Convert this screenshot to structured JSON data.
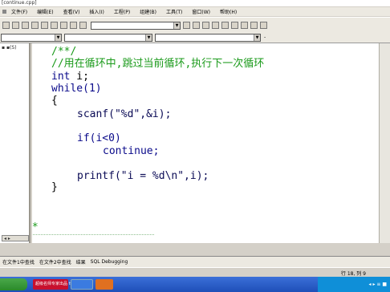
{
  "window": {
    "title": "[continue.cpp]"
  },
  "menu": {
    "items": [
      "文件(F)",
      "编辑(E)",
      "查看(V)",
      "插入(I)",
      "工程(P)",
      "组建(B)",
      "工具(T)",
      "窗口(W)",
      "帮助(H)"
    ]
  },
  "toolbar": {
    "minus_label": "-"
  },
  "leftpane": {
    "header": "▪ ▪(S)",
    "tab_label": "◂ ▸"
  },
  "code": {
    "l1": "/**/",
    "l2": "//用在循环中,跳过当前循环,执行下一次循环",
    "l3_kw": "int",
    "l3_rest": " i;",
    "l4": "while(1)",
    "l5": "{",
    "l6": "scanf(\"%d\",&i);",
    "l7": "if(i<0)",
    "l8": "continue;",
    "l9": "printf(\"i = %d\\n\",i);",
    "l10": "}",
    "l11": "/*"
  },
  "output_tabs": [
    "在文件1中查找",
    "在文件2中查找",
    "结果",
    "SQL Debugging"
  ],
  "statusbar": {
    "position": "行 18, 列 9"
  },
  "taskbar": {
    "buttons": [
      "超级名师专家出品 ttcsoft.com",
      "",
      ""
    ],
    "tray": "◂ ▸ ≡ ■"
  },
  "colors": {
    "comment": "#1a9a1a",
    "keyword": "#0a0a8a",
    "taskbar": "#2456c4"
  }
}
